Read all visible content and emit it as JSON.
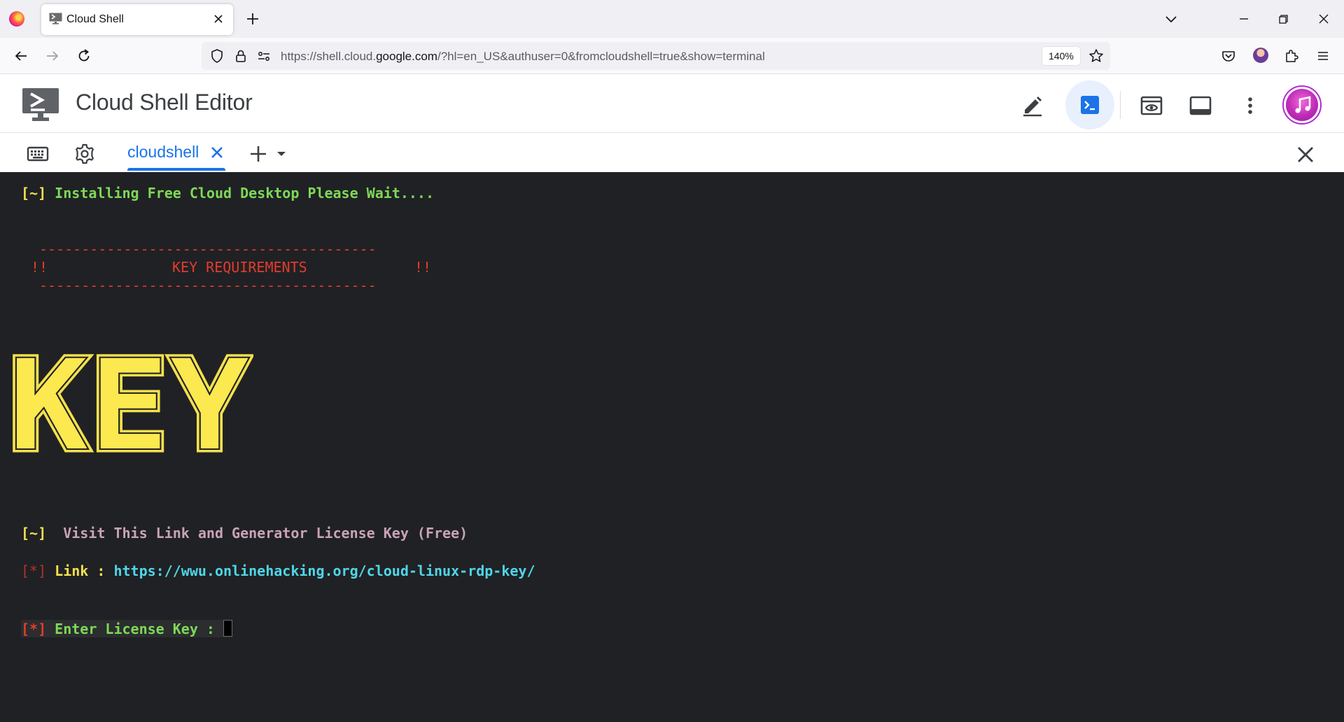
{
  "browser": {
    "tab_title": "Cloud Shell",
    "url_prefix": "https://shell.cloud.",
    "url_host": "google.com",
    "url_rest": "/?hl=en_US&authuser=0&fromcloudshell=true&show=terminal",
    "zoom": "140%"
  },
  "app": {
    "title": "Cloud Shell Editor",
    "accent": "#1a73e8"
  },
  "terminal_tabs": {
    "active_label": "cloudshell"
  },
  "terminal": {
    "line1_prefix": "[~]",
    "line1_text": " Installing Free Cloud Desktop Please Wait....",
    "dash_line": "----------------------------------------",
    "req_left": "!!",
    "req_title": "KEY REQUIREMENTS",
    "req_right": "!!",
    "ascii_word": "KEY",
    "visit_prefix": "[~]",
    "visit_text": "  Visit This Link and Generator License Key (Free)",
    "link_prefix": "[*]",
    "link_label": " Link : ",
    "link_url": "https://wwu.onlinehacking.org/cloud-linux-rdp-key/",
    "enter_prefix": "[*]",
    "enter_text": " Enter License Key : "
  },
  "icons": {
    "browser_logo": "firefox-logo",
    "tab_favicon": "cloud-shell-favicon",
    "header_edit": "pencil-icon",
    "header_terminal": "terminal-icon",
    "header_preview": "web-preview-icon",
    "header_layout": "layout-icon",
    "header_more": "more-vert-icon"
  }
}
